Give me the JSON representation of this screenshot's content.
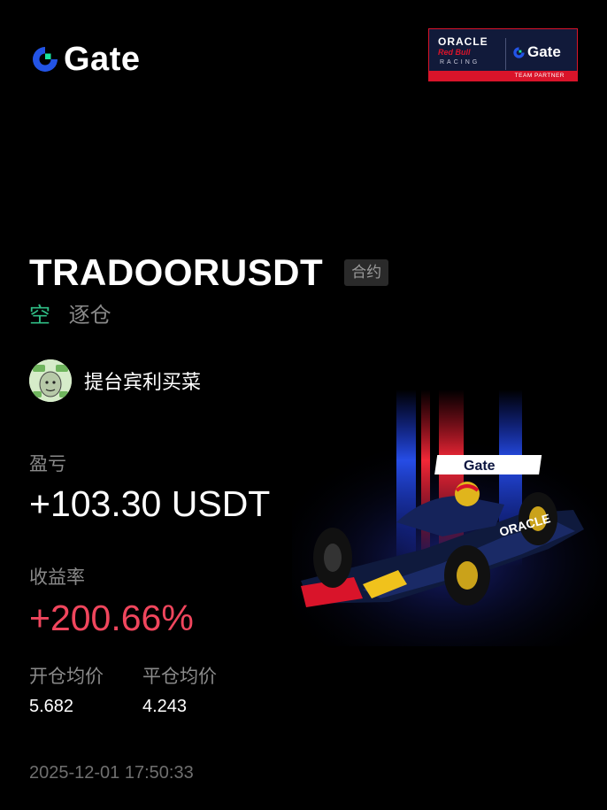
{
  "brand": {
    "name": "Gate"
  },
  "partner": {
    "oracle": "ORACLE",
    "redbull": "Red Bull",
    "racing": "RACING",
    "gate": "Gate",
    "label": "TEAM PARTNER"
  },
  "position": {
    "pair": "TRADOORUSDT",
    "type_tag": "合约",
    "direction": "空",
    "margin_mode": "逐仓"
  },
  "user": {
    "name": "提台宾利买菜"
  },
  "pnl": {
    "label": "盈亏",
    "value": "+103.30 USDT"
  },
  "roi": {
    "label": "收益率",
    "value": "+200.66%"
  },
  "prices": {
    "open_label": "开仓均价",
    "open_value": "5.682",
    "close_label": "平仓均价",
    "close_value": "4.243"
  },
  "timestamp": "2025-12-01 17:50:33",
  "colors": {
    "background": "#000000",
    "short": "#2fbd85",
    "roi": "#f0465d",
    "brand_blue": "#2354e6",
    "brand_green": "#17e6a1"
  }
}
